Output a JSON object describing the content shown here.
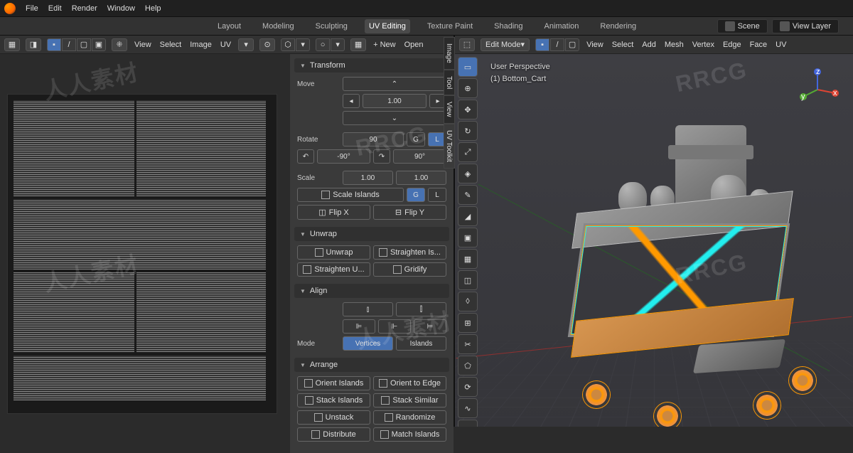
{
  "topbar": {
    "menus": [
      "File",
      "Edit",
      "Render",
      "Window",
      "Help"
    ]
  },
  "workspaces": {
    "items": [
      "Layout",
      "Modeling",
      "Sculpting",
      "UV Editing",
      "Texture Paint",
      "Shading",
      "Animation",
      "Rendering"
    ],
    "active": 3,
    "scene": "Scene",
    "viewlayer": "View Layer"
  },
  "uv_header": {
    "menus": [
      "View",
      "Select",
      "Image",
      "UV"
    ],
    "new": "+ New",
    "open": "Open"
  },
  "npanel_tabs": [
    "Image",
    "Tool",
    "View",
    "UV Toolkit"
  ],
  "transform": {
    "title": "Transform",
    "move": "Move",
    "move_val": "1.00",
    "rotate": "Rotate",
    "rotate_val": "90",
    "g": "G",
    "l": "L",
    "neg90": "-90°",
    "pos90": "90°",
    "scale": "Scale",
    "scale_v1": "1.00",
    "scale_v2": "1.00",
    "scale_islands": "Scale Islands",
    "flipx": "Flip X",
    "flipy": "Flip Y"
  },
  "unwrap": {
    "title": "Unwrap",
    "unwrap": "Unwrap",
    "straighten_is": "Straighten Is...",
    "straighten_u": "Straighten U...",
    "gridify": "Gridify"
  },
  "align": {
    "title": "Align",
    "mode": "Mode",
    "vertices": "Vertices",
    "islands": "Islands"
  },
  "arrange": {
    "title": "Arrange",
    "orient_islands": "Orient Islands",
    "orient_edge": "Orient to Edge",
    "stack_islands": "Stack Islands",
    "stack_similar": "Stack Similar",
    "unstack": "Unstack",
    "randomize": "Randomize",
    "distribute": "Distribute",
    "match_islands": "Match Islands"
  },
  "vp_header": {
    "mode": "Edit Mode",
    "menus": [
      "View",
      "Select",
      "Add",
      "Mesh",
      "Vertex",
      "Edge",
      "Face",
      "UV"
    ]
  },
  "vp_info": {
    "perspective": "User Perspective",
    "object": "(1) Bottom_Cart"
  },
  "watermark": "RRCG",
  "watermark_cn": "人人素材"
}
